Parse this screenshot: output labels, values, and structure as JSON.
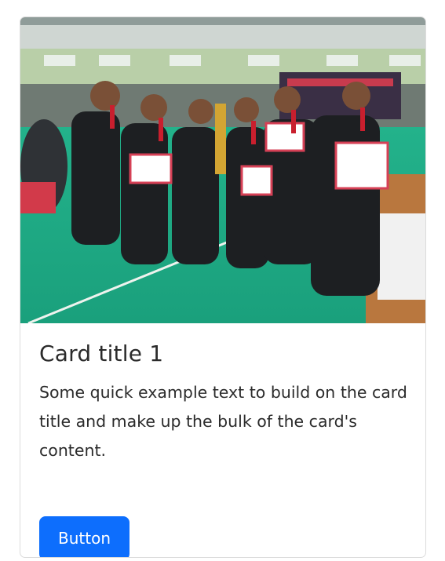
{
  "card": {
    "title": "Card title 1",
    "text": "Some quick example text to build on the card title and make up the bulk of the card's content.",
    "button_label": "Button",
    "image_alt": "Group photo of martial arts team holding certificates and trophy"
  },
  "colors": {
    "button_bg": "#0d6efd",
    "button_text": "#ffffff",
    "title_text": "#2b2b2b",
    "body_text": "#2b2b2b",
    "card_border": "#dcdcdc"
  }
}
